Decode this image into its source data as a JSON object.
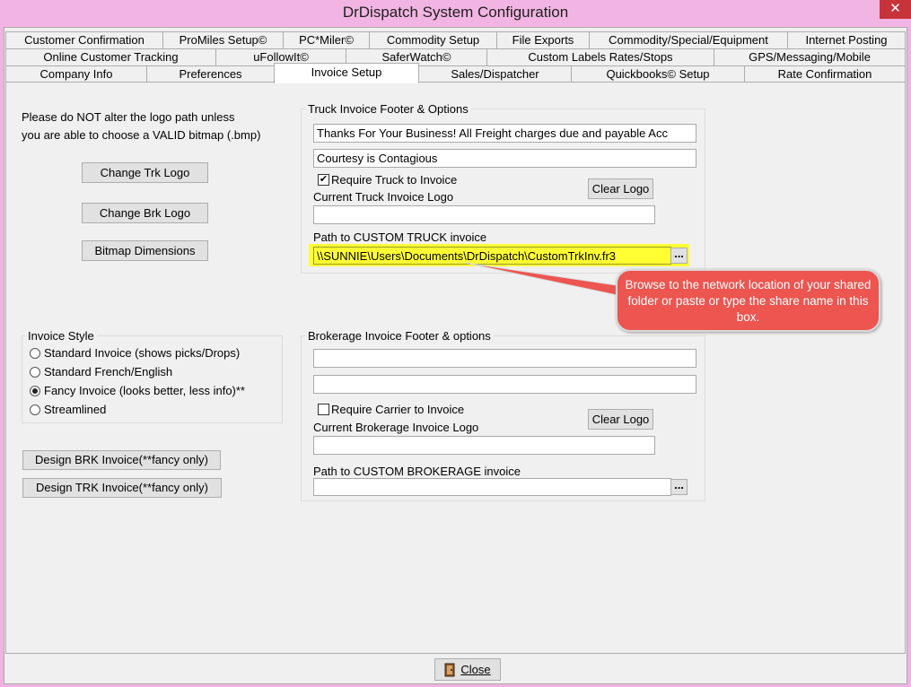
{
  "window": {
    "title": "DrDispatch  System Configuration",
    "close_glyph": "✕"
  },
  "tabs": {
    "row1": [
      "Customer Confirmation",
      "ProMiles Setup©",
      "PC*Miler©",
      "Commodity Setup",
      "File Exports",
      "Commodity/Special/Equipment",
      "Internet Posting"
    ],
    "row2": [
      "Online Customer Tracking",
      "uFollowIt©",
      "SaferWatch©",
      "Custom Labels Rates/Stops",
      "GPS/Messaging/Mobile"
    ],
    "row3": [
      "Company Info",
      "Preferences",
      "Invoice Setup",
      "Sales/Dispatcher",
      "Quickbooks© Setup",
      "Rate Confirmation"
    ],
    "active": "Invoice Setup"
  },
  "logo_notice": {
    "line1": "Please do NOT alter the logo path unless",
    "line2": "you are able to choose a VALID bitmap (.bmp)"
  },
  "left_buttons": {
    "change_trk_logo": "Change Trk Logo",
    "change_brk_logo": "Change Brk Logo",
    "bitmap_dimensions": "Bitmap Dimensions"
  },
  "invoice_style": {
    "label": "Invoice Style",
    "options": [
      "Standard Invoice (shows picks/Drops)",
      "Standard French/English",
      "Fancy Invoice (looks better, less info)**",
      "Streamlined"
    ],
    "selected_index": 2
  },
  "design_buttons": {
    "brk": "Design BRK Invoice(**fancy only)",
    "trk": "Design TRK Invoice(**fancy only)"
  },
  "truck_group": {
    "label": "Truck Invoice Footer & Options",
    "footer_line1": "Thanks For Your Business!  All Freight charges due and payable Acc",
    "footer_line2": "Courtesy is Contagious",
    "require_label": "Require Truck to Invoice",
    "require_checked": true,
    "check_glyph": "✔",
    "clear_logo": "Clear Logo",
    "current_logo_label": "Current Truck Invoice Logo",
    "current_logo_value": "",
    "path_label": "Path to CUSTOM TRUCK invoice",
    "path_value": "\\\\SUNNIE\\Users\\Documents\\DrDispatch\\CustomTrkInv.fr3",
    "browse": "..."
  },
  "brokerage_group": {
    "label": "Brokerage Invoice Footer & options",
    "footer_line1": "",
    "footer_line2": "",
    "require_label": "Require Carrier to Invoice",
    "require_checked": false,
    "clear_logo": "Clear Logo",
    "current_logo_label": "Current Brokerage Invoice Logo",
    "current_logo_value": "",
    "path_label": "Path to CUSTOM BROKERAGE invoice",
    "path_value": "",
    "browse": "..."
  },
  "callout": {
    "text": "Browse to the network location of your shared folder or paste or type the share name in this box."
  },
  "footer": {
    "close_label": "Close",
    "close_icon": "door-exit-icon"
  },
  "colors": {
    "titlebar": "#f2b5e3",
    "close_red": "#c7333a",
    "highlight": "#ffff33",
    "callout": "#ec5550"
  }
}
